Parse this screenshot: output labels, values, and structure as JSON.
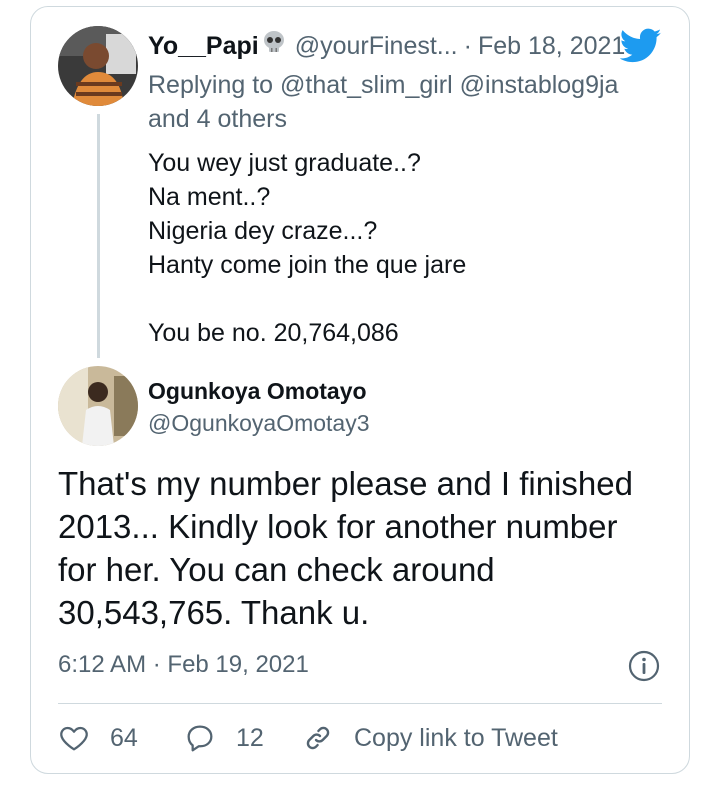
{
  "tweet_parent": {
    "display_name": "Yo__Papi",
    "name_emoji": "skull-emoji",
    "handle": "@yourFinest...",
    "separator": "·",
    "date": "Feb 18, 2021",
    "replying_prefix": "Replying to",
    "replying_mentions": "@that_slim_girl @instablog9ja",
    "replying_others": "and 4 others",
    "lines": [
      "You wey just graduate..?",
      "Na ment..?",
      "Nigeria dey craze...?",
      "Hanty come join the que jare",
      "",
      "You be no. 20,764,086"
    ]
  },
  "tweet_main": {
    "display_name": "Ogunkoya Omotayo",
    "handle": "@OgunkoyaOmotay3",
    "lines": [
      "That's my number please and I finished",
      "2013... Kindly look for another number",
      "for her. You can check around",
      "30,543,765. Thank u."
    ],
    "time": "6:12 AM",
    "separator": "·",
    "date": "Feb 19, 2021"
  },
  "actions": {
    "like_count": "64",
    "reply_count": "12",
    "copy_link_label": "Copy link to Tweet"
  },
  "colors": {
    "text": "#0f1419",
    "secondary": "#536471",
    "border": "#cfd9de",
    "twitter_blue": "#1d9bf0"
  }
}
